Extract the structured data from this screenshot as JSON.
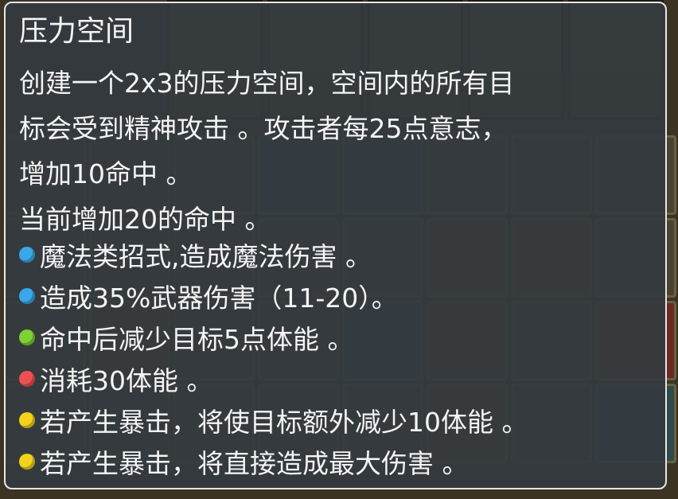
{
  "tooltip": {
    "title": "压力空间",
    "description_lines": [
      "创建一个2x3的压力空间，空间内的所有目",
      "标会受到精神攻击 。攻击者每25点意志，",
      "增加10命中 。",
      "当前增加20的命中 。"
    ],
    "effects": [
      {
        "text": "魔法类招式,造成魔法伤害 。",
        "color": "#3aa7e8"
      },
      {
        "text": "造成35%武器伤害（11-20）。",
        "color": "#3aa7e8"
      },
      {
        "text": "命中后减少目标5点体能 。",
        "color": "#7ed132"
      },
      {
        "text": "消耗30体能 。",
        "color": "#ec5050"
      },
      {
        "text": "若产生暴击，将使目标额外减少10体能 。",
        "color": "#f2d21a"
      },
      {
        "text": "若产生暴击，将直接造成最大伤害 。",
        "color": "#f2d21a"
      }
    ]
  }
}
